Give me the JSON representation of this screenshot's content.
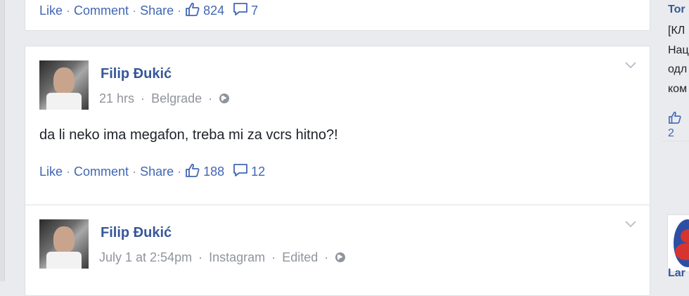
{
  "post_top": {
    "actions": {
      "like": "Like",
      "comment": "Comment",
      "share": "Share"
    },
    "likes_count": "824",
    "comments_count": "7"
  },
  "post_1": {
    "author": "Filip Đukić",
    "time": "21 hrs",
    "location": "Belgrade",
    "text": "da li neko ima megafon, treba mi za vcrs hitno?!",
    "actions": {
      "like": "Like",
      "comment": "Comment",
      "share": "Share"
    },
    "likes_count": "188",
    "comments_count": "12"
  },
  "post_2": {
    "author": "Filip Đukić",
    "time": "July 1 at 2:54pm",
    "source": "Instagram",
    "edited": "Edited"
  },
  "sidebar": {
    "name_partial": "Tor",
    "lines": [
      "[КЛ",
      "Нац",
      "одл",
      "ком"
    ],
    "like_count_partial": "2",
    "next_partial": "Lar"
  },
  "colors": {
    "link": "#4267b2",
    "name": "#365899",
    "meta": "#90949c",
    "text": "#1d2129",
    "background": "#e9ebee"
  }
}
